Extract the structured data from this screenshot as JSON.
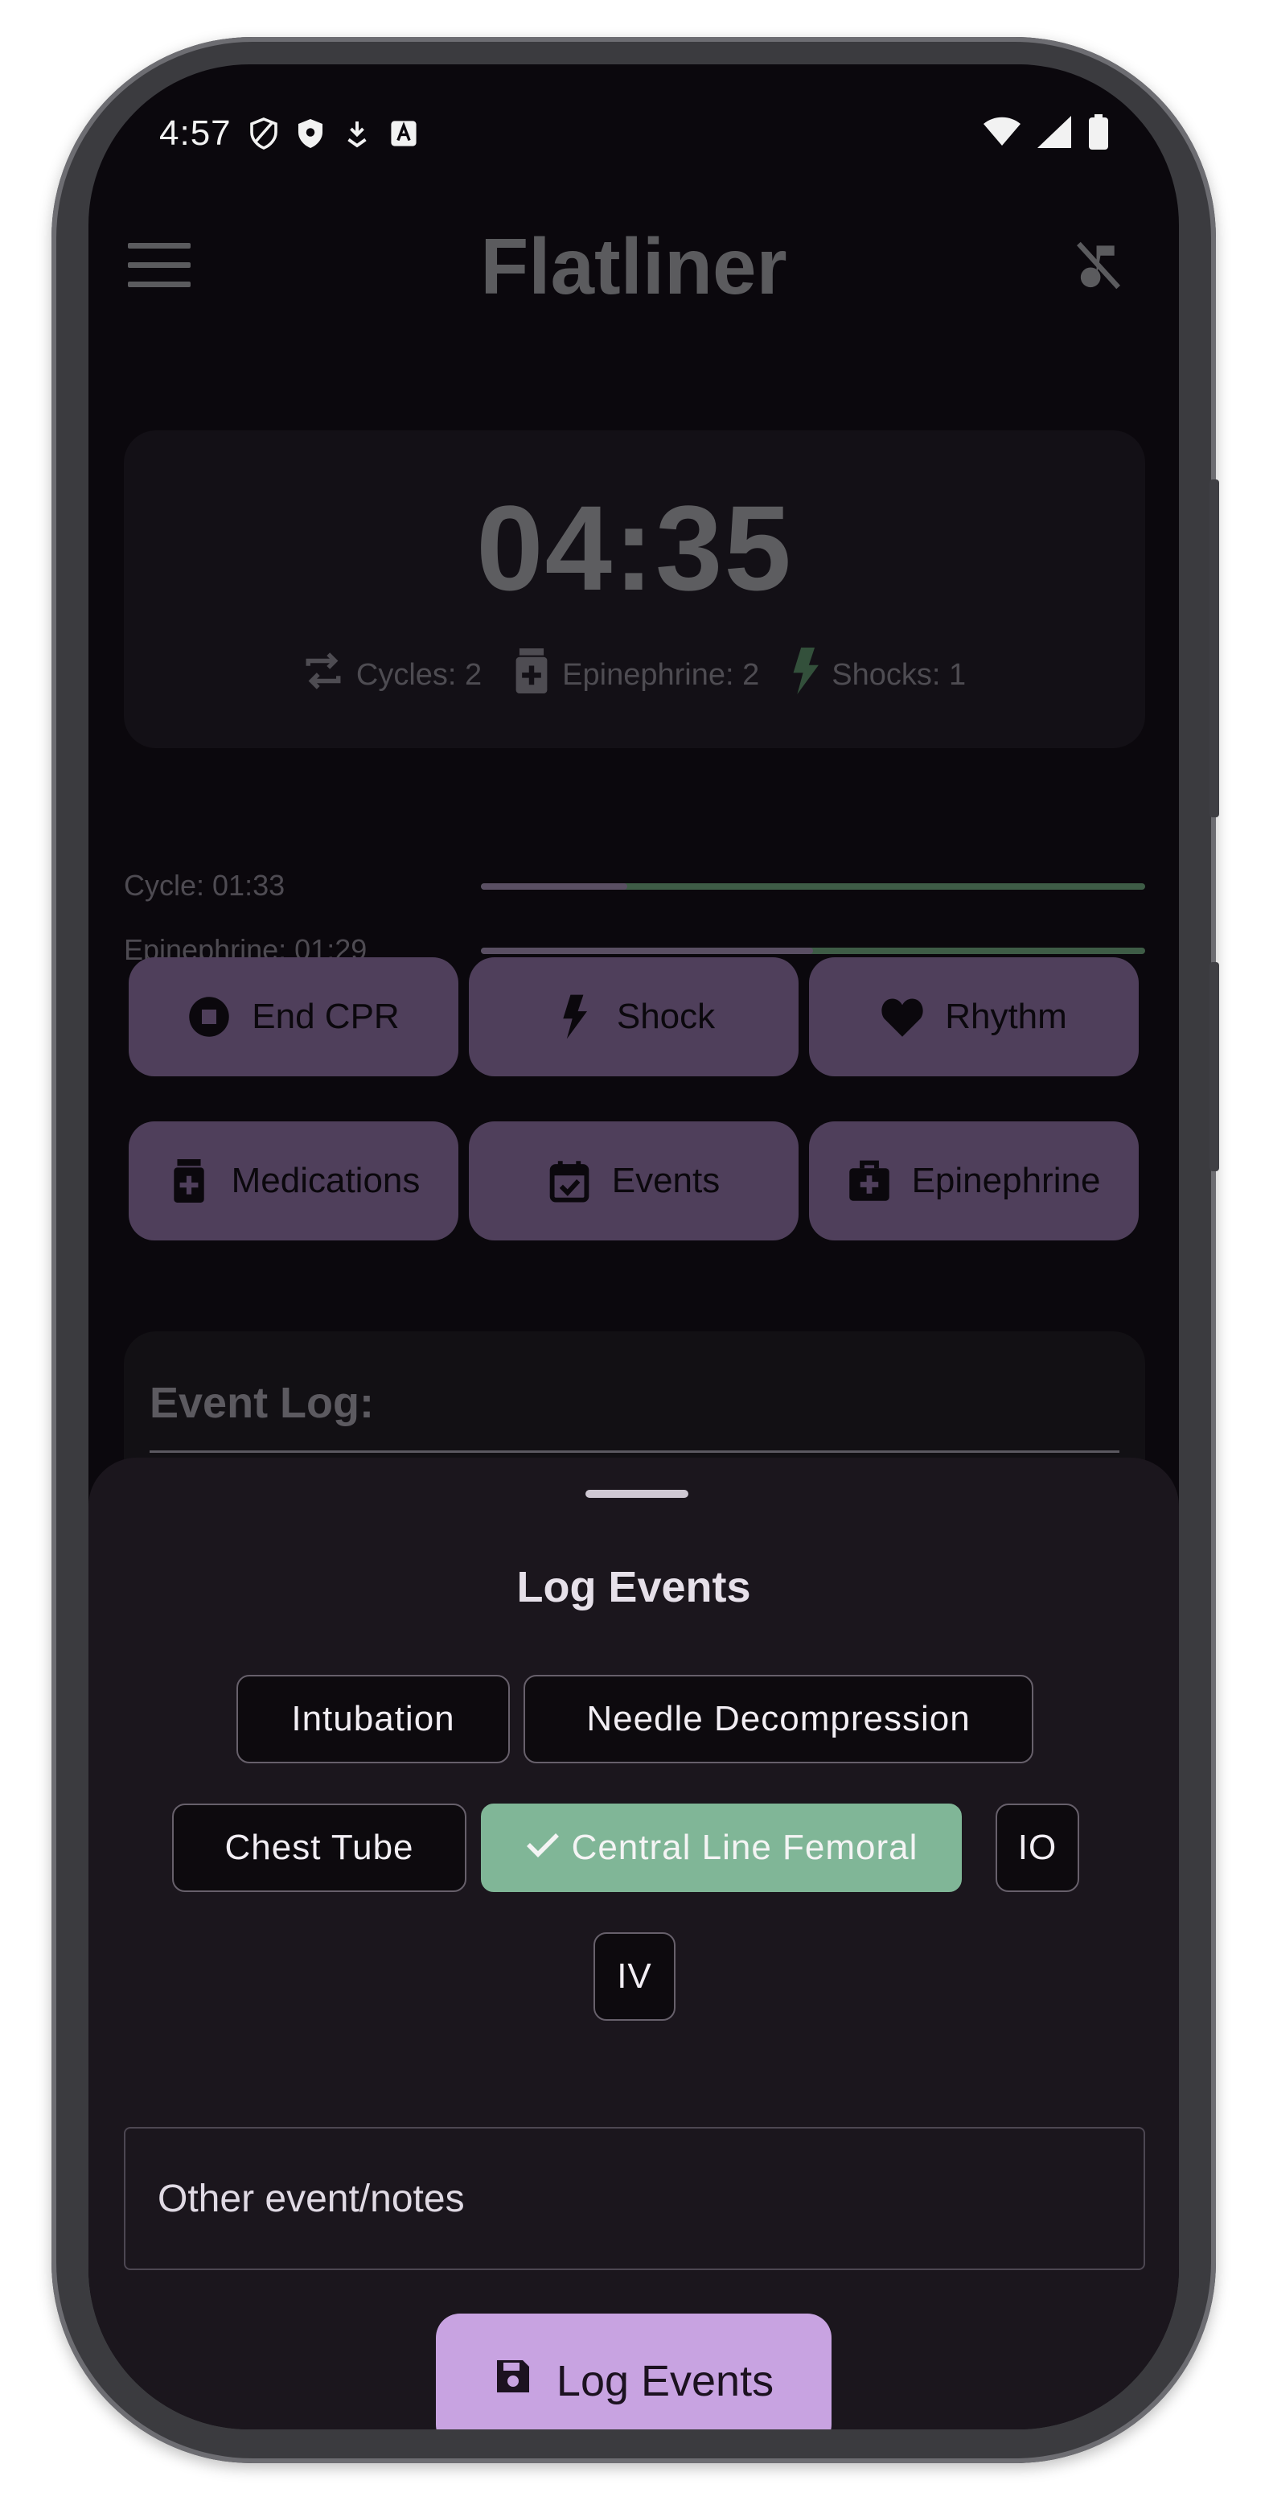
{
  "status_bar": {
    "time": "4:57",
    "left_icons": [
      "shield-outline-icon",
      "shield-filled-icon",
      "download-icon",
      "font-icon"
    ],
    "right_icons": [
      "wifi-icon",
      "signal-icon",
      "battery-icon"
    ]
  },
  "app_bar": {
    "title": "Flatliner",
    "menu_icon": "hamburger-menu-icon",
    "action_icon": "music-off-icon"
  },
  "timer": {
    "value": "04:35",
    "stats": [
      {
        "icon": "repeat-icon",
        "label": "Cycles: 2"
      },
      {
        "icon": "medication-icon",
        "label": "Epinephrine: 2"
      },
      {
        "icon": "bolt-icon",
        "label": "Shocks: 1"
      }
    ]
  },
  "progress": [
    {
      "label": "Cycle: 01:33",
      "fraction": 0.22
    },
    {
      "label": "Epinephrine: 01:29",
      "fraction": 0.5
    }
  ],
  "actions": [
    {
      "label": "End CPR",
      "icon": "stop-circle-icon"
    },
    {
      "label": "Shock",
      "icon": "bolt-icon"
    },
    {
      "label": "Rhythm",
      "icon": "heart-icon"
    },
    {
      "label": "Medications",
      "icon": "medication-icon"
    },
    {
      "label": "Events",
      "icon": "calendar-check-icon"
    },
    {
      "label": "Epinephrine",
      "icon": "medical-bag-icon"
    }
  ],
  "event_log": {
    "title": "Event Log:"
  },
  "sheet": {
    "title": "Log Events",
    "chips": [
      {
        "label": "Intubation",
        "selected": false
      },
      {
        "label": "Needle Decompression",
        "selected": false
      },
      {
        "label": "Chest Tube",
        "selected": false
      },
      {
        "label": "Central Line Femoral",
        "selected": true
      },
      {
        "label": "IO",
        "selected": false
      },
      {
        "label": "IV",
        "selected": false
      }
    ],
    "notes_placeholder": "Other event/notes",
    "save_label": "Log Events",
    "save_icon": "save-icon"
  },
  "colors": {
    "screen_bg": "#0b080d",
    "sheet_bg": "#1b161d",
    "action_bg": "#4f3f5b",
    "selected_chip": "#80b697",
    "primary_button": "#c8a3e1",
    "progress_done": "#3e5c46"
  }
}
